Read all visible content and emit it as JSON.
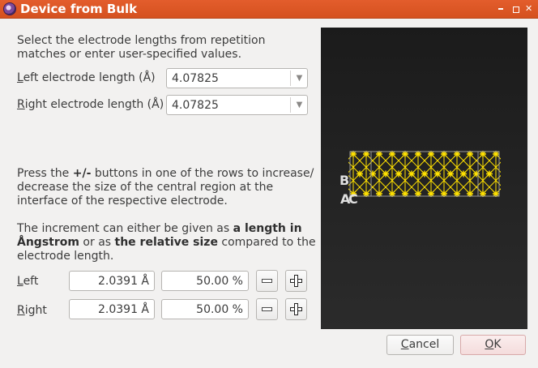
{
  "window": {
    "title": "Device from Bulk",
    "restore_icon": "restore-icon",
    "maximize_icon": "maximize-icon",
    "close_icon": "close-icon"
  },
  "electrodes": {
    "intro_line1": "Select the electrode lengths from repetition",
    "intro_line2": "matches or enter user-specified values.",
    "left_label_accel": "L",
    "left_label_rest": "eft electrode length (Å)",
    "left_value": "4.07825",
    "right_label_accel": "R",
    "right_label_rest": "ight electrode length (Å)",
    "right_value": "4.07825",
    "dropdown_icon": "chevron-down-icon"
  },
  "central_region": {
    "para1_pre": "Press the ",
    "para1_bold": "+/-",
    "para1_post": " buttons in one of the rows to increase/",
    "para1_line2": "decrease the size of the central region at the",
    "para1_line3": "interface of the respective electrode.",
    "para2_pre": "The increment can either be given as ",
    "para2_bold1": "a length in",
    "para2_bold2": "Ångstrom",
    "para2_mid": " or as ",
    "para2_bold3": "the relative size",
    "para2_post": " compared to the",
    "para2_line3": "electrode length.",
    "rows": [
      {
        "label_accel": "L",
        "label_rest": "eft",
        "length": "2.0391 Å",
        "percent": "50.00 %"
      },
      {
        "label_accel": "R",
        "label_rest": "ight",
        "length": "2.0391 Å",
        "percent": "50.00 %"
      }
    ],
    "minus_icon": "minus-icon",
    "plus_icon": "plus-icon"
  },
  "viewer": {
    "axis_b": "B",
    "axis_a": "A",
    "axis_c": "C",
    "background": "#222222",
    "atom_color": "#ffe100"
  },
  "buttons": {
    "cancel_accel": "C",
    "cancel_rest": "ancel",
    "ok_accel": "O",
    "ok_rest": "K"
  },
  "colors": {
    "titlebar": "#dd5626",
    "ok_button": "#f4dcdc"
  }
}
